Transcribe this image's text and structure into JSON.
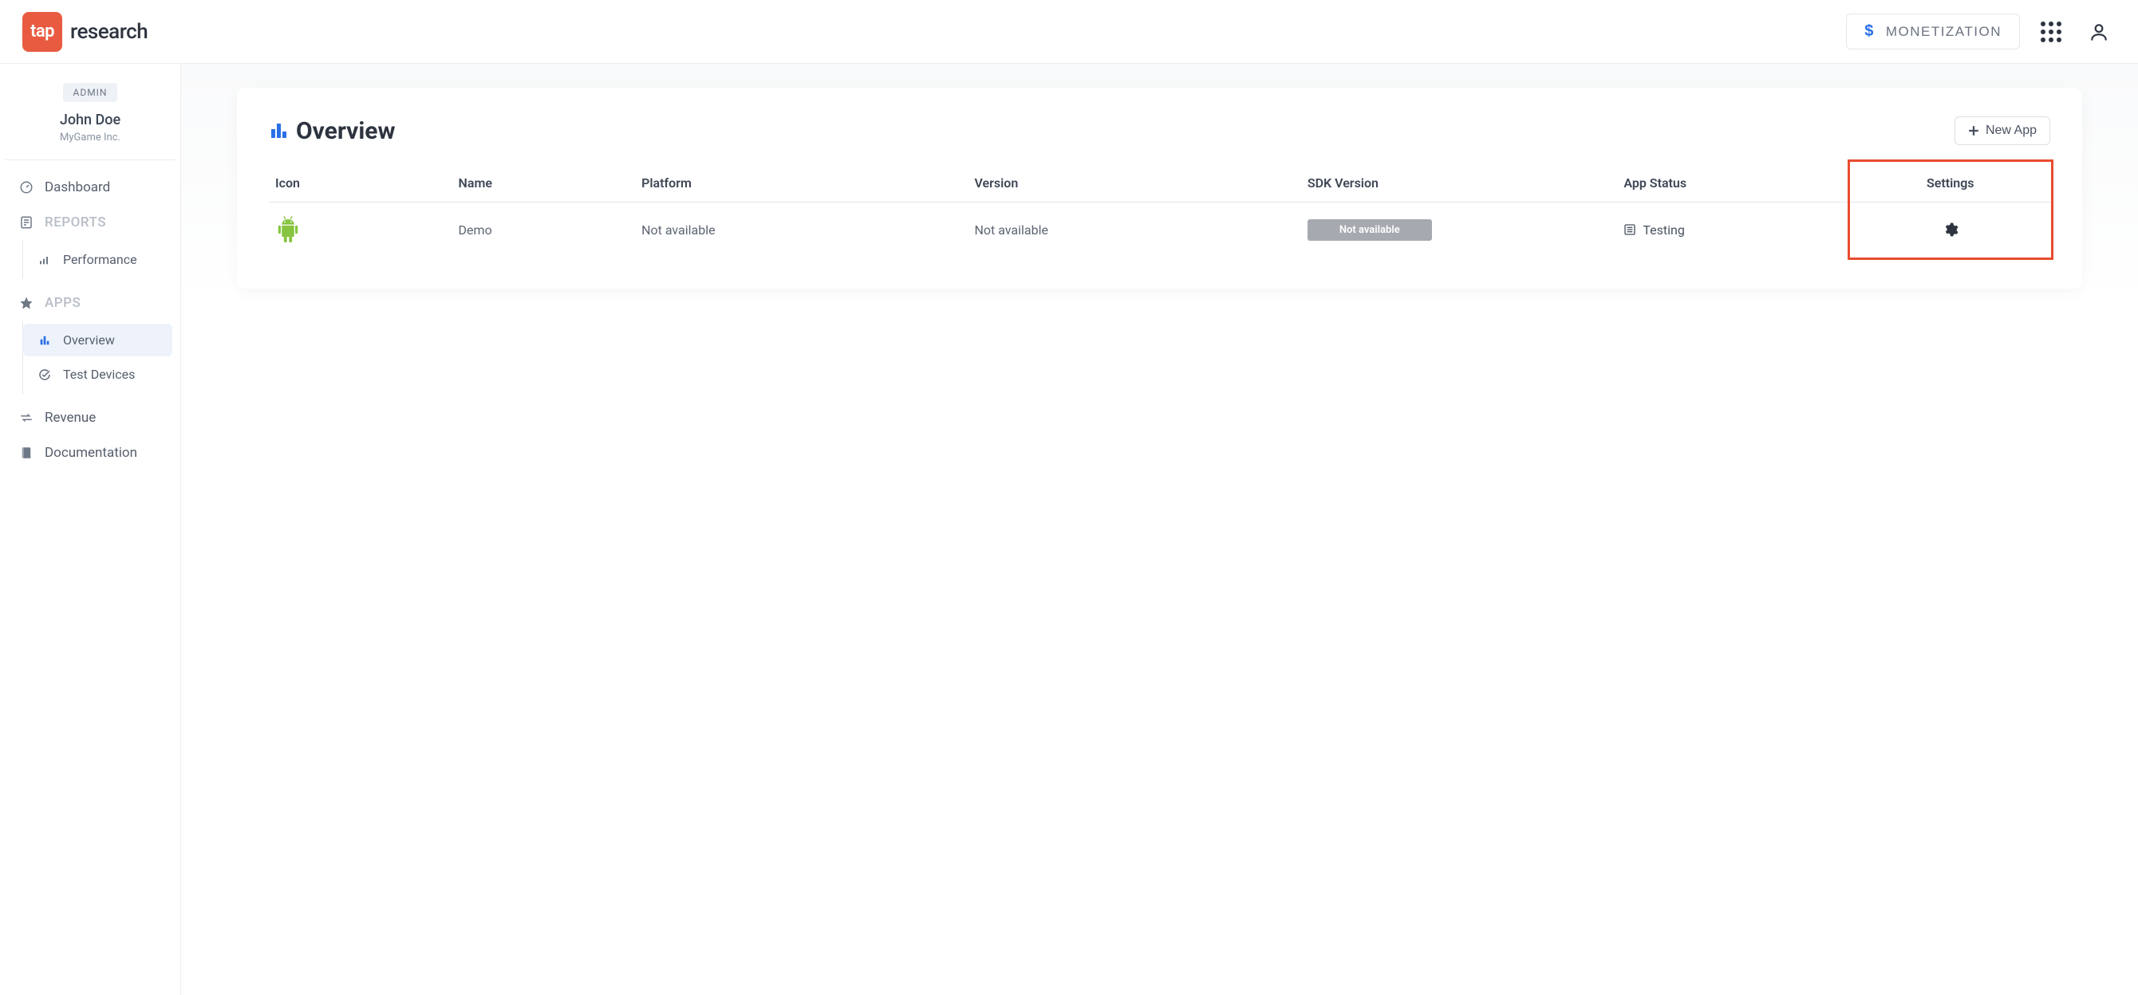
{
  "brand": {
    "mark": "tap",
    "name": "research"
  },
  "topbar": {
    "monetization_label": "MONETIZATION"
  },
  "sidebar": {
    "admin_chip": "ADMIN",
    "user_name": "John Doe",
    "company": "MyGame Inc.",
    "dashboard": "Dashboard",
    "reports_section": "REPORTS",
    "performance": "Performance",
    "apps_section": "APPS",
    "overview": "Overview",
    "test_devices": "Test Devices",
    "revenue": "Revenue",
    "documentation": "Documentation"
  },
  "page": {
    "title": "Overview",
    "new_app_label": "New App"
  },
  "table": {
    "headers": {
      "icon": "Icon",
      "name": "Name",
      "platform": "Platform",
      "version": "Version",
      "sdk_version": "SDK Version",
      "app_status": "App Status",
      "settings": "Settings"
    },
    "rows": [
      {
        "name": "Demo",
        "platform": "Not available",
        "version": "Not available",
        "sdk_version": "Not available",
        "app_status": "Testing"
      }
    ]
  }
}
